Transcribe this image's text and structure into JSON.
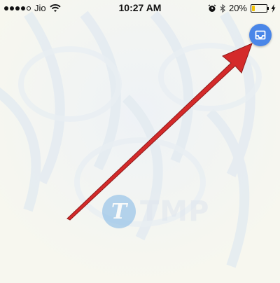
{
  "status_bar": {
    "carrier": "Jio",
    "time": "10:27 AM",
    "battery_percent": "20%",
    "battery_level": 0.2,
    "signal_bars": 4,
    "signal_max": 5,
    "icons": [
      "signal-icon",
      "wifi-icon",
      "alarm-icon",
      "bluetooth-icon",
      "battery-icon",
      "charging-icon"
    ]
  },
  "fab": {
    "icon": "inbox-icon",
    "color": "#4a86e8"
  },
  "annotation": {
    "arrow_color": "#d42a2a"
  },
  "watermark": {
    "logo_letter": "T",
    "text": "TMP"
  }
}
